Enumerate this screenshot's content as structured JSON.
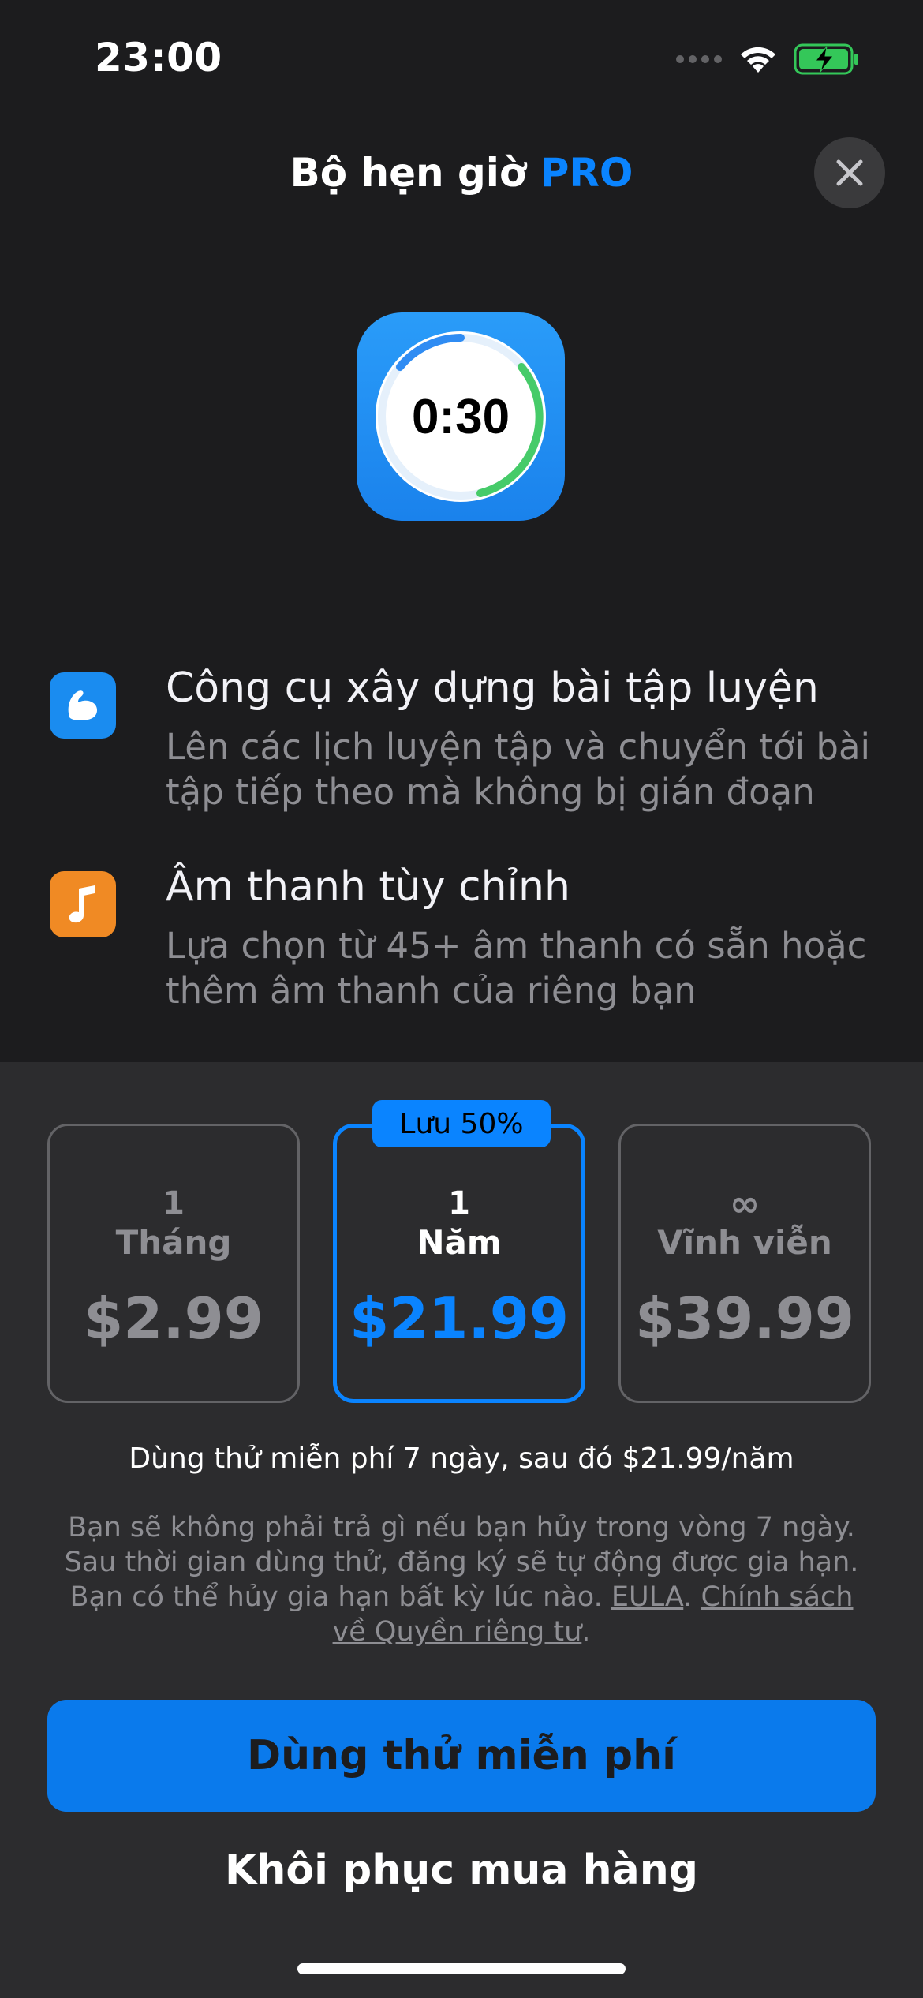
{
  "status_bar": {
    "time": "23:00"
  },
  "header": {
    "title": "Bộ hẹn giờ",
    "title_accent": "PRO"
  },
  "app_icon": {
    "timer_text": "0:30"
  },
  "features": [
    {
      "icon": "flexed-bicep-icon",
      "title": "Công cụ xây dựng bài tập luyện",
      "desc_line1": "Lên các lịch luyện tập và chuyển tới bài",
      "desc_line2": "tập tiếp theo mà không bị gián đoạn"
    },
    {
      "icon": "music-note-icon",
      "title": "Âm thanh tùy chỉnh",
      "desc_line1": "Lựa chọn từ 45+ âm thanh có sẵn hoặc",
      "desc_line2": "thêm âm thanh của riêng bạn"
    }
  ],
  "plans": [
    {
      "qty": "1",
      "unit": "Tháng",
      "price": "$2.99",
      "selected": false
    },
    {
      "qty": "1",
      "unit": "Năm",
      "price": "$21.99",
      "selected": true,
      "badge": "Lưu 50%"
    },
    {
      "qty": "∞",
      "unit": "Vĩnh viễn",
      "price": "$39.99",
      "selected": false
    }
  ],
  "trial_note": "Dùng thử miễn phí 7 ngày, sau đó $21.99/năm",
  "legal": {
    "text": "Bạn sẽ không phải trả gì nếu bạn hủy trong vòng 7 ngày. Sau thời gian dùng thử, đăng ký sẽ tự động được gia hạn. Bạn có thể hủy gia hạn bất kỳ lúc nào.",
    "eula": "EULA",
    "sep": ".",
    "privacy": "Chính sách về Quyền riêng tư",
    "end": "."
  },
  "cta_label": "Dùng thử miễn phí",
  "restore_label": "Khôi phục mua hàng",
  "colors": {
    "accent": "#0a84ff",
    "background": "#1c1c1e",
    "panel": "#2c2c2e",
    "bicep_icon": "#1a8cf0",
    "music_icon": "#f08a24"
  }
}
